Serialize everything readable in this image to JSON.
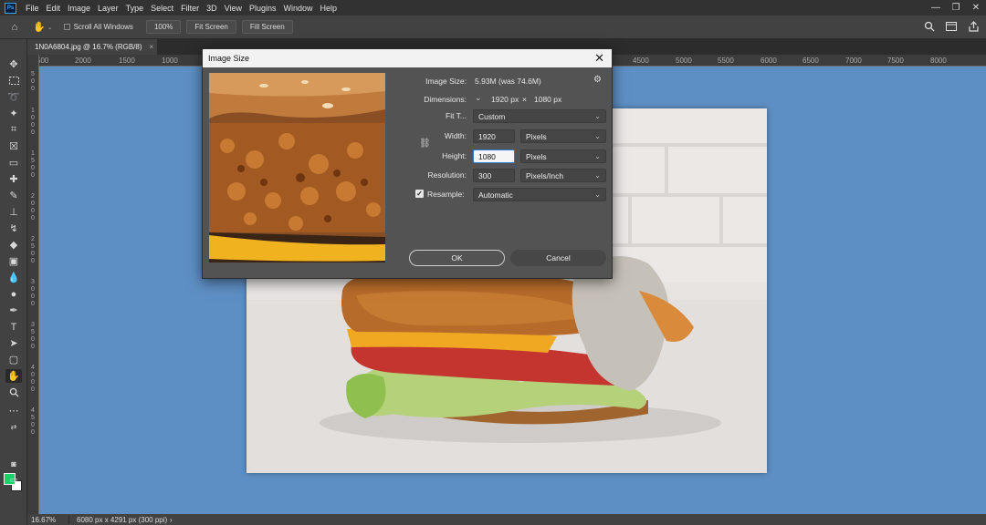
{
  "menubar": {
    "logo": "Ps",
    "items": [
      "File",
      "Edit",
      "Image",
      "Layer",
      "Type",
      "Select",
      "Filter",
      "3D",
      "View",
      "Plugins",
      "Window",
      "Help"
    ]
  },
  "options": {
    "scroll_all_label": "Scroll All Windows",
    "zoom_100": "100%",
    "fit_screen": "Fit Screen",
    "fill_screen": "Fill Screen"
  },
  "document": {
    "tab_title": "1N0A6804.jpg @ 16.7% (RGB/8)"
  },
  "rulers": {
    "top": [
      "500",
      "2000",
      "1500",
      "1000",
      "4500",
      "5000",
      "5500",
      "6000",
      "6500",
      "7000",
      "7500",
      "8000"
    ],
    "left": [
      "5\n0\n0",
      "1\n0\n0\n0",
      "1\n5\n0\n0",
      "2\n0\n0\n0",
      "2\n5\n0\n0",
      "3\n0\n0\n0",
      "3\n5\n0\n0",
      "4\n0\n0\n0",
      "4\n5\n0\n0"
    ]
  },
  "status": {
    "zoom": "16.67%",
    "info": "6080 px x 4291 px (300 ppi)",
    "arrow": "›"
  },
  "dialog": {
    "title": "Image Size",
    "image_size_label": "Image Size:",
    "image_size_value": "5.93M (was 74.6M)",
    "dimensions_label": "Dimensions:",
    "dim_width": "1920 px",
    "dim_x": "×",
    "dim_height": "1080 px",
    "fit_label": "Fit T...",
    "fit_value": "Custom",
    "width_label": "Width:",
    "width_value": "1920",
    "width_unit": "Pixels",
    "height_label": "Height:",
    "height_value": "1080",
    "height_unit": "Pixels",
    "resolution_label": "Resolution:",
    "resolution_value": "300",
    "resolution_unit": "Pixels/Inch",
    "resample_label": "Resample:",
    "resample_value": "Automatic",
    "ok": "OK",
    "cancel": "Cancel"
  },
  "colors": {
    "foreground": "#19d26b",
    "background": "#ffffff",
    "canvas": "#5e8fc4"
  }
}
